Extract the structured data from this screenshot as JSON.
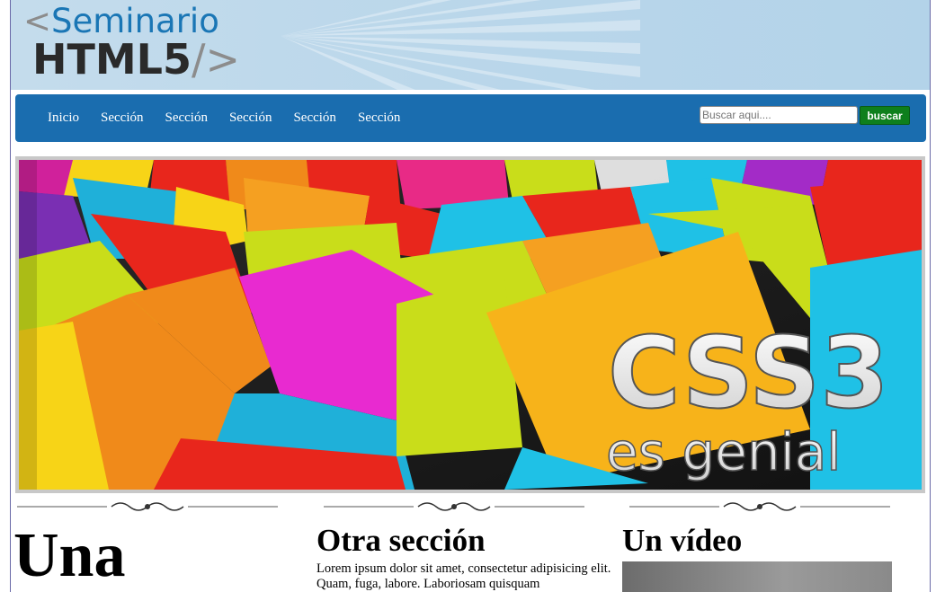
{
  "logo": {
    "bracket_open": "<",
    "word1": "Seminario",
    "word2": "HTML5",
    "bracket_close": "/>"
  },
  "nav": {
    "items": [
      {
        "label": "Inicio"
      },
      {
        "label": "Sección"
      },
      {
        "label": "Sección"
      },
      {
        "label": "Sección"
      },
      {
        "label": "Sección"
      },
      {
        "label": "Sección"
      }
    ]
  },
  "search": {
    "placeholder": "Buscar aqui....",
    "button_label": "buscar"
  },
  "banner": {
    "title": "CSS3",
    "subtitle": "es genial"
  },
  "columns": {
    "col1_title": "Una",
    "col2_title": "Otra sección",
    "col2_text": "Lorem ipsum dolor sit amet, consectetur adipisicing elit. Quam, fuga, labore. Laboriosam quisquam",
    "col3_title": "Un vídeo"
  },
  "colors": {
    "header_bg": "#b9d6ea",
    "nav_bg": "#1a6daf",
    "search_button_bg": "#0e7f1c",
    "logo_blue": "#1a76b5"
  }
}
